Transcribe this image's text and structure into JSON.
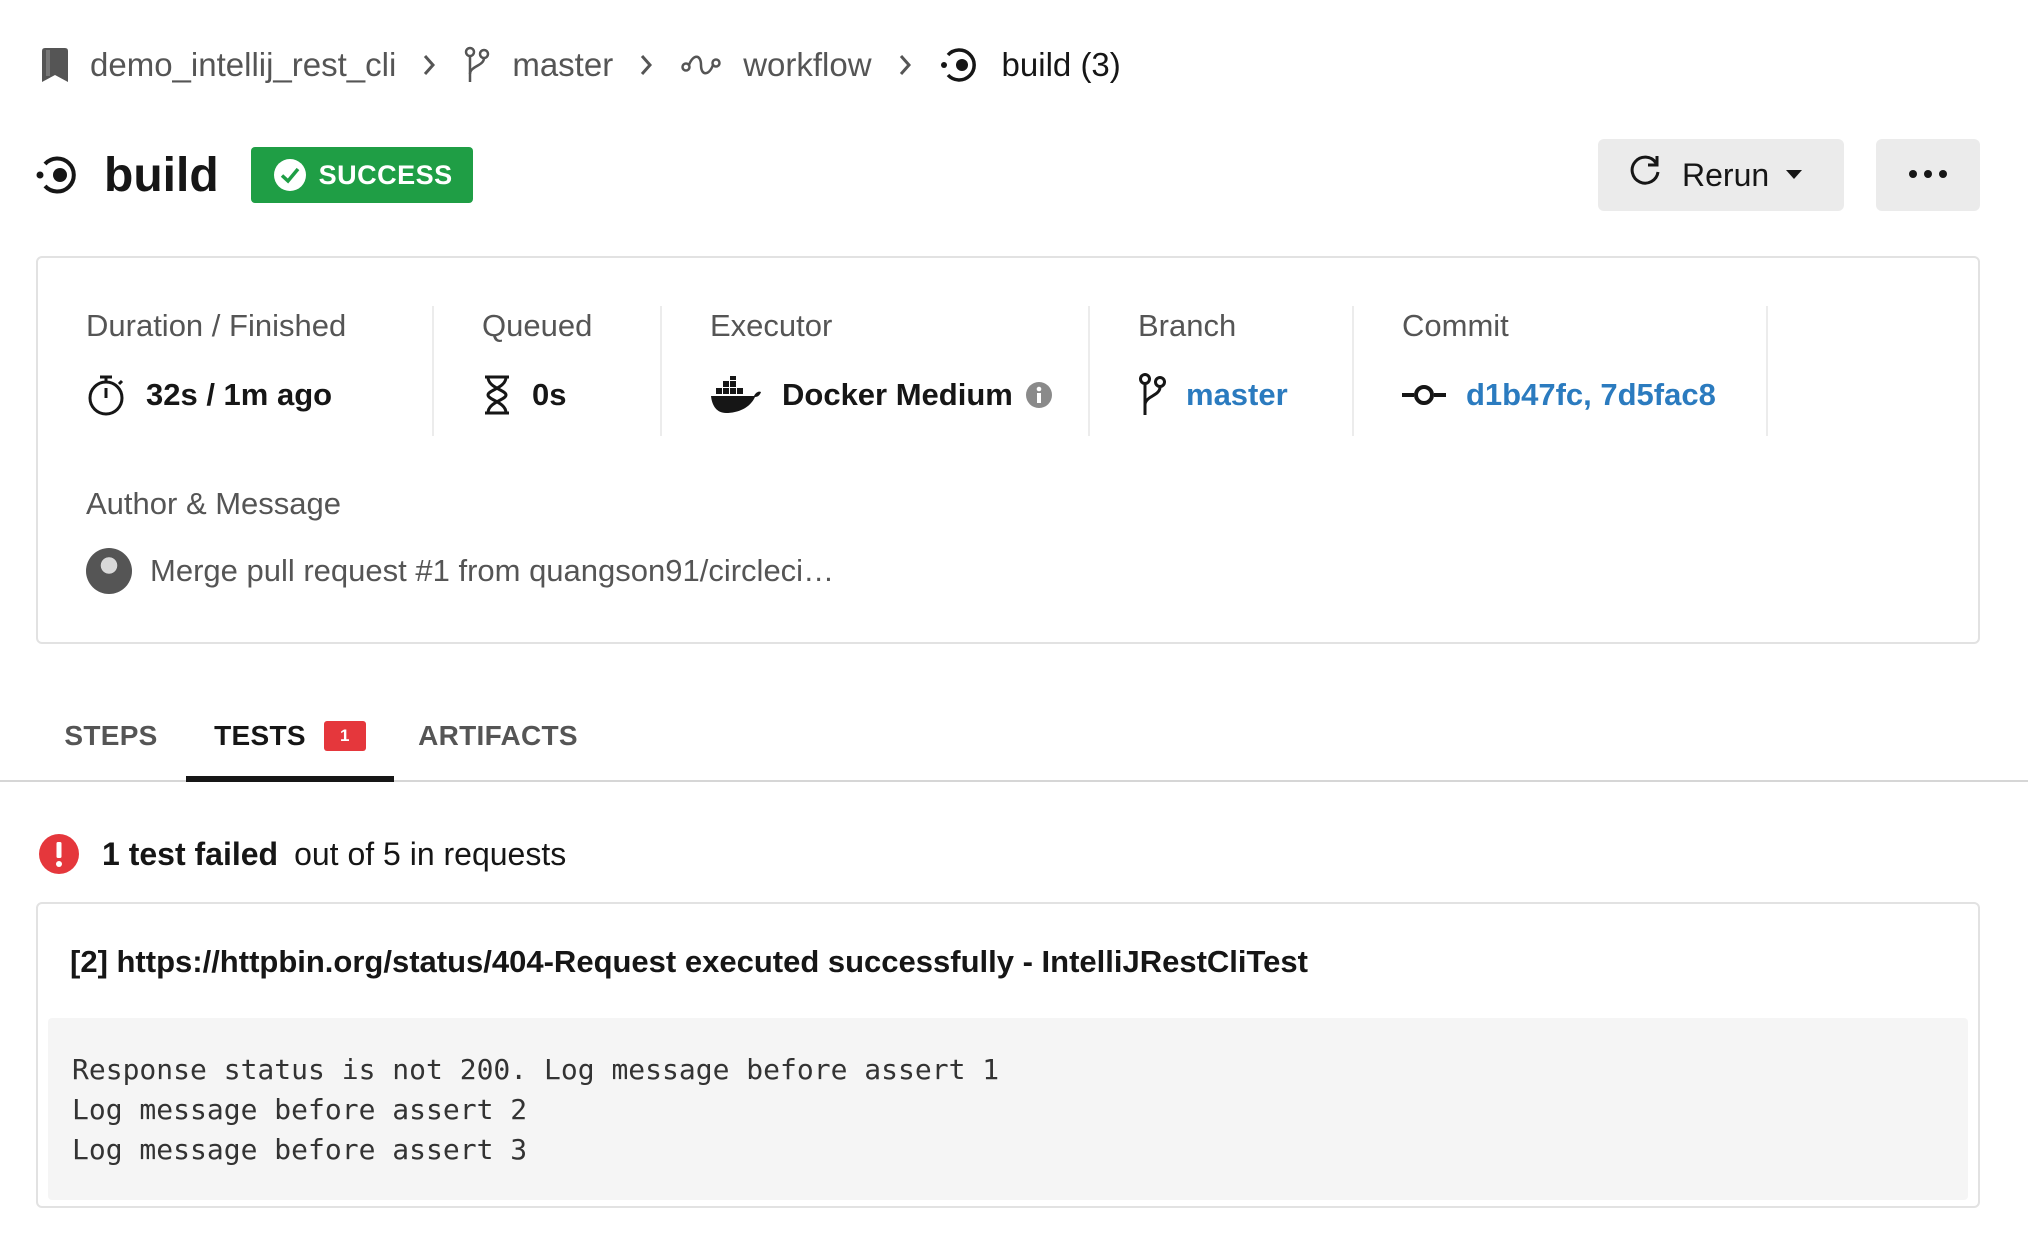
{
  "breadcrumb": {
    "project": "demo_intellij_rest_cli",
    "branch": "master",
    "workflow": "workflow",
    "job": "build (3)"
  },
  "header": {
    "title": "build",
    "status": "SUCCESS",
    "rerun_label": "Rerun"
  },
  "details": {
    "duration": {
      "label": "Duration / Finished",
      "value": "32s / 1m ago"
    },
    "queued": {
      "label": "Queued",
      "value": "0s"
    },
    "executor": {
      "label": "Executor",
      "value": "Docker Medium"
    },
    "branch": {
      "label": "Branch",
      "value": "master"
    },
    "commit": {
      "label": "Commit",
      "value": "d1b47fc, 7d5fac8"
    },
    "author": {
      "label": "Author & Message",
      "message": "Merge pull request #1 from quangson91/circleci…"
    }
  },
  "tabs": [
    {
      "label": "STEPS"
    },
    {
      "label": "TESTS",
      "count": "1"
    },
    {
      "label": "ARTIFACTS"
    }
  ],
  "summary": {
    "failed": "1 test failed",
    "rest": "out of 5 in requests"
  },
  "test": {
    "name": "[2] https://httpbin.org/status/404-Request executed successfully - IntelliJRestCliTest",
    "log": [
      "Response status is not 200. Log message before assert 1",
      "Log message before assert 2",
      "Log message before assert 3"
    ]
  },
  "colors": {
    "success": "#1f9e45",
    "error": "#e5373c",
    "link": "#2b7bbf"
  }
}
